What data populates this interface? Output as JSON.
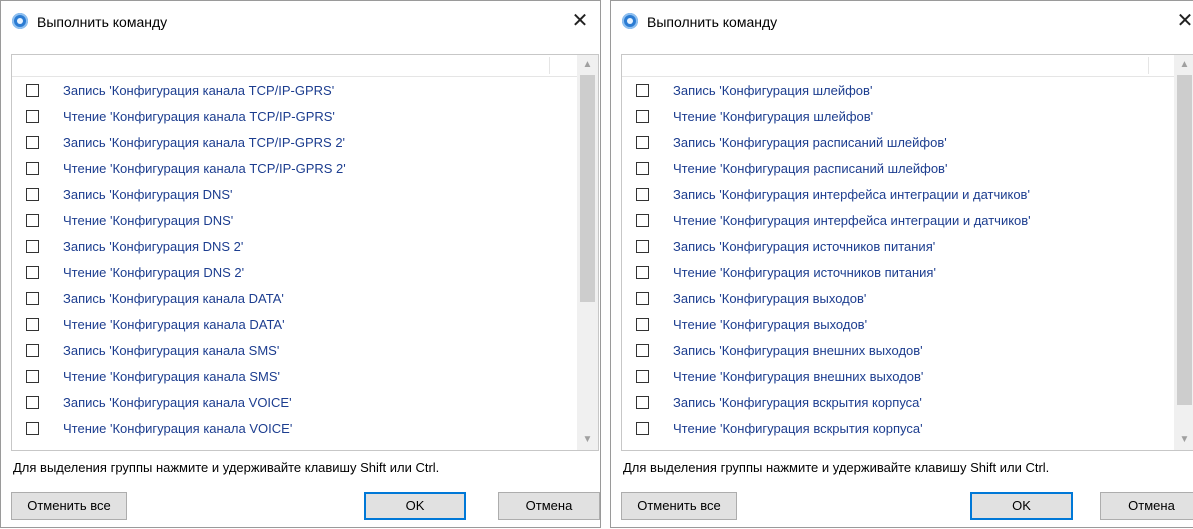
{
  "dialogs": [
    {
      "title": "Выполнить команду",
      "close_glyph": "✕",
      "commands": [
        "Запись 'Конфигурация канала TCP/IP-GPRS'",
        "Чтение 'Конфигурация канала TCP/IP-GPRS'",
        "Запись 'Конфигурация канала TCP/IP-GPRS 2'",
        "Чтение 'Конфигурация канала TCP/IP-GPRS 2'",
        "Запись 'Конфигурация DNS'",
        "Чтение 'Конфигурация DNS'",
        "Запись 'Конфигурация DNS 2'",
        "Чтение 'Конфигурация DNS 2'",
        "Запись 'Конфигурация канала DATA'",
        "Чтение 'Конфигурация канала DATA'",
        "Запись 'Конфигурация канала SMS'",
        "Чтение 'Конфигурация канала SMS'",
        "Запись 'Конфигурация канала VOICE'",
        "Чтение 'Конфигурация канала VOICE'"
      ],
      "hint": "Для выделения группы нажмите и удерживайте клавишу Shift или Ctrl.",
      "buttons": {
        "deselect_all": "Отменить все",
        "ok": "OK",
        "cancel": "Отмена"
      }
    },
    {
      "title": "Выполнить команду",
      "close_glyph": "✕",
      "commands": [
        "Запись 'Конфигурация шлейфов'",
        "Чтение 'Конфигурация шлейфов'",
        "Запись 'Конфигурация расписаний шлейфов'",
        "Чтение 'Конфигурация расписаний шлейфов'",
        "Запись 'Конфигурация интерфейса интеграции и датчиков'",
        "Чтение 'Конфигурация интерфейса интеграции и датчиков'",
        "Запись 'Конфигурация источников питания'",
        "Чтение 'Конфигурация источников питания'",
        "Запись 'Конфигурация выходов'",
        "Чтение 'Конфигурация выходов'",
        "Запись 'Конфигурация внешних выходов'",
        "Чтение 'Конфигурация внешних выходов'",
        "Запись 'Конфигурация вскрытия корпуса'",
        "Чтение 'Конфигурация вскрытия корпуса'"
      ],
      "hint": "Для выделения группы нажмите и удерживайте клавишу Shift или Ctrl.",
      "buttons": {
        "deselect_all": "Отменить все",
        "ok": "OK",
        "cancel": "Отмена"
      }
    }
  ],
  "icons": {
    "app": "app-icon",
    "close": "close-icon",
    "scroll_up": "scroll-up-arrow-icon",
    "scroll_down": "scroll-down-arrow-icon"
  },
  "colors": {
    "command_text": "#1c3d8f",
    "default_button_border": "#0078d7",
    "button_face": "#e1e1e1"
  }
}
